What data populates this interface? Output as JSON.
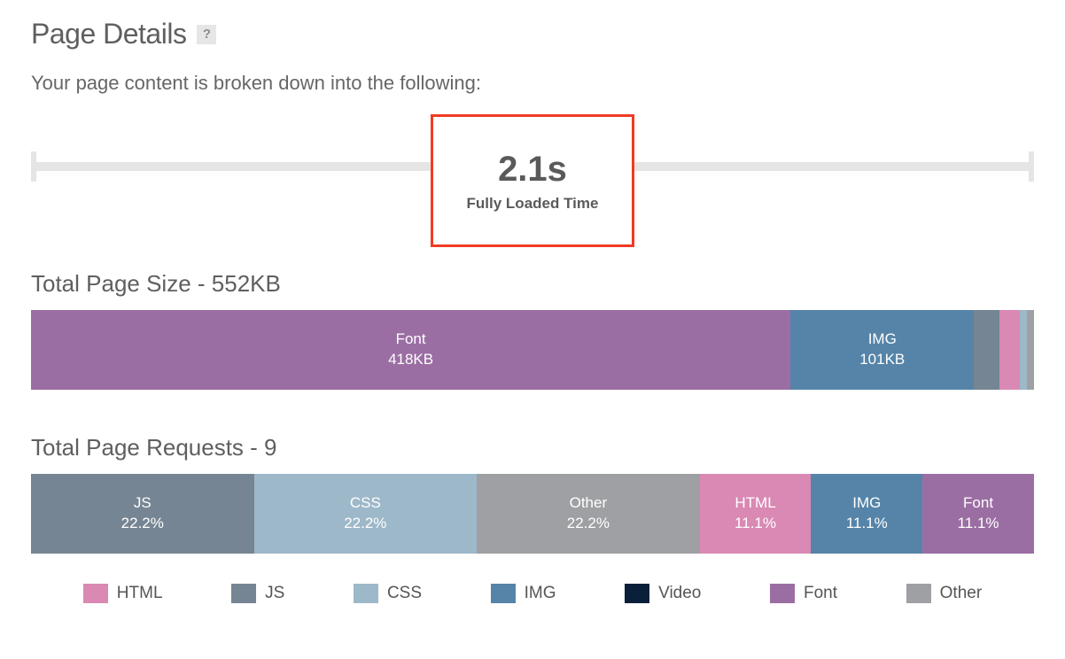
{
  "header": {
    "title": "Page Details",
    "help_label": "?",
    "subtitle": "Your page content is broken down into the following:"
  },
  "timing": {
    "value": "2.1s",
    "label": "Fully Loaded Time"
  },
  "colors": {
    "HTML": "#d989b3",
    "JS": "#758593",
    "CSS": "#9db8c9",
    "IMG": "#5584a8",
    "Video": "#0a1f3a",
    "Font": "#9b6ea3",
    "Other": "#9ea0a3"
  },
  "size_section": {
    "title": "Total Page Size - 552KB"
  },
  "requests_section": {
    "title": "Total Page Requests - 9"
  },
  "legend_order": [
    "HTML",
    "JS",
    "CSS",
    "IMG",
    "Video",
    "Font",
    "Other"
  ],
  "chart_data": [
    {
      "type": "bar",
      "title": "Total Page Size - 552KB",
      "unit": "KB",
      "total": 552,
      "segments": [
        {
          "name": "Font",
          "value": 418,
          "display": "418KB",
          "show_label": true
        },
        {
          "name": "IMG",
          "value": 101,
          "display": "101KB",
          "show_label": true
        },
        {
          "name": "JS",
          "value": 14,
          "display": "14KB",
          "show_label": false
        },
        {
          "name": "HTML",
          "value": 11,
          "display": "11KB",
          "show_label": false
        },
        {
          "name": "CSS",
          "value": 4,
          "display": "4KB",
          "show_label": false
        },
        {
          "name": "Other",
          "value": 4,
          "display": "4KB",
          "show_label": false
        }
      ]
    },
    {
      "type": "bar",
      "title": "Total Page Requests - 9",
      "unit": "%",
      "total": 100,
      "segments": [
        {
          "name": "JS",
          "value": 22.2,
          "display": "22.2%",
          "show_label": true
        },
        {
          "name": "CSS",
          "value": 22.2,
          "display": "22.2%",
          "show_label": true
        },
        {
          "name": "Other",
          "value": 22.2,
          "display": "22.2%",
          "show_label": true
        },
        {
          "name": "HTML",
          "value": 11.1,
          "display": "11.1%",
          "show_label": true
        },
        {
          "name": "IMG",
          "value": 11.1,
          "display": "11.1%",
          "show_label": true
        },
        {
          "name": "Font",
          "value": 11.1,
          "display": "11.1%",
          "show_label": true
        }
      ]
    }
  ]
}
